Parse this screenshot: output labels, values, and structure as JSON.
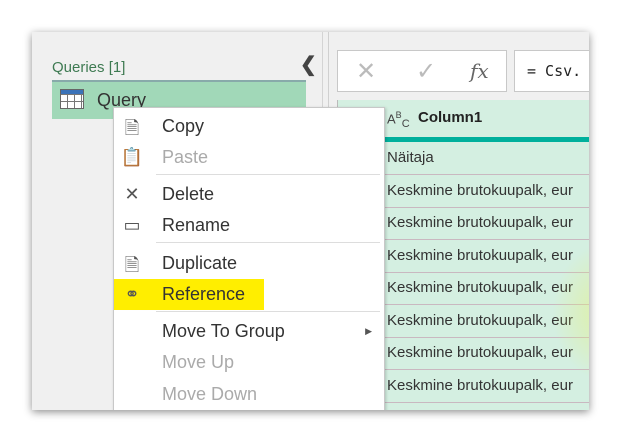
{
  "queries_pane": {
    "title": "Queries [1]",
    "collapse_icon": "chevron-left-icon",
    "items": [
      {
        "label": "Query",
        "icon": "table-icon"
      }
    ]
  },
  "formula_bar": {
    "cancel_icon": "x-icon",
    "commit_icon": "check-icon",
    "fx_label": "fx",
    "formula": "= Csv."
  },
  "grid": {
    "type_icon": "ABC",
    "column_header": "Column1",
    "rows": [
      "Näitaja",
      "Keskmine brutokuupalk, eur",
      "Keskmine brutokuupalk, eur",
      "Keskmine brutokuupalk, eur",
      "Keskmine brutokuupalk, eur",
      "Keskmine brutokuupalk, eur",
      "Keskmine brutokuupalk, eur",
      "Keskmine brutokuupalk, eur"
    ]
  },
  "context_menu": {
    "items": [
      {
        "label": "Copy",
        "icon": "copy-icon",
        "enabled": true
      },
      {
        "label": "Paste",
        "icon": "paste-icon",
        "enabled": false
      },
      {
        "label": "Delete",
        "icon": "delete-icon",
        "enabled": true
      },
      {
        "label": "Rename",
        "icon": "rename-icon",
        "enabled": true
      },
      {
        "label": "Duplicate",
        "icon": "duplicate-icon",
        "enabled": true
      },
      {
        "label": "Reference",
        "icon": "reference-icon",
        "enabled": true,
        "highlighted": true
      },
      {
        "label": "Move To Group",
        "enabled": true,
        "submenu": true
      },
      {
        "label": "Move Up",
        "enabled": false
      },
      {
        "label": "Move Down",
        "enabled": false
      }
    ]
  },
  "colors": {
    "highlight": "#ffee00",
    "selected_query": "#a1d8b8",
    "grid_bg": "#d4efe1",
    "column_accent": "#00b09c"
  }
}
